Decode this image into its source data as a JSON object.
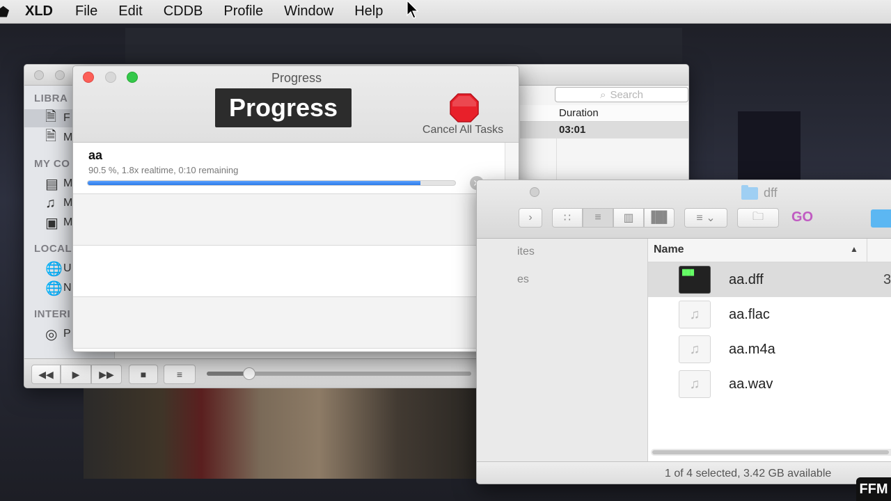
{
  "menubar": {
    "app_name": "XLD",
    "items": [
      "File",
      "Edit",
      "CDDB",
      "Profile",
      "Window",
      "Help"
    ]
  },
  "library": {
    "sidebar": {
      "sections": [
        "LIBRA",
        "MY CO",
        "LOCAL",
        "INTERI"
      ],
      "items": [
        "F",
        "M",
        "M",
        "M",
        "M",
        "U",
        "N",
        "P"
      ]
    },
    "search_placeholder": "Search",
    "table": {
      "column_duration": "Duration",
      "row_duration": "03:01"
    },
    "controls": {
      "prev": "◀◀",
      "play": "▶",
      "next": "▶▶",
      "stop": "■",
      "list": "≡"
    },
    "playback_position": 0.16
  },
  "progress": {
    "window_title": "Progress",
    "overlay_title": "Progress",
    "cancel_all_label": "Cancel All Tasks",
    "tasks": [
      {
        "name": "aa",
        "status": "90.5 %, 1.8x realtime, 0:10 remaining",
        "progress": 0.905
      }
    ]
  },
  "finder": {
    "title": "dff",
    "go_label": "GO",
    "sidebar": [
      "ites",
      "es"
    ],
    "column_name": "Name",
    "files": [
      {
        "name": "aa.dff",
        "selected": true,
        "size_prefix": "3"
      },
      {
        "name": "aa.flac",
        "selected": false
      },
      {
        "name": "aa.m4a",
        "selected": false
      },
      {
        "name": "aa.wav",
        "selected": false
      }
    ],
    "status": "1 of 4 selected, 3.42 GB available"
  },
  "watermark": "FFM",
  "colors": {
    "progress_blue": "#2c7ce8",
    "stop_red": "#e8202a",
    "go_purple": "#c05bc2",
    "close_red": "#fc5f57",
    "zoom_green": "#34c84a"
  }
}
